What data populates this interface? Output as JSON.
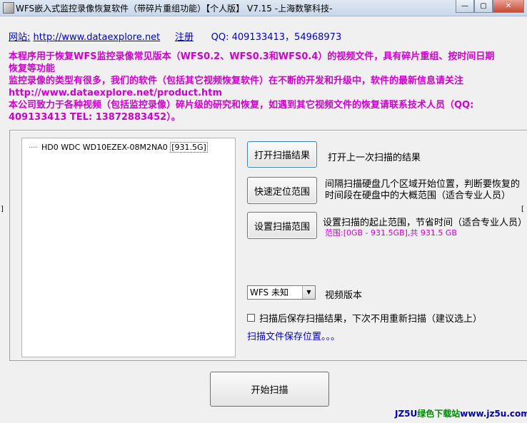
{
  "window": {
    "title": "WFS嵌入式监控录像恢复软件（带碎片重组功能）【个人版】 V7.15  -上海数擎科技-",
    "btn_minimize": "—",
    "btn_maximize": "▢",
    "btn_close": "✕"
  },
  "header": {
    "website_label": "网站:",
    "website_url": "http://www.dataexplore.net",
    "register": "注册",
    "qq": "QQ: 409133413，54968973"
  },
  "notice": [
    "本程序用于恢复WFS监控录像常见版本（WFS0.2、WFS0.3和WFS0.4）的视频文件，具有碎片重组、按时间日期恢复等功能",
    "监控录像的类型有很多，我们的软件（包括其它视频恢复软件）在不断的开发和升级中，软件的最新信息请关注 http://www.dataexplore.net/product.htm",
    "本公司致力于各种视频（包括监控录像）碎片级的研究和恢复，如遇到其它视频文件的恢复请联系技术人员（QQ: 409133413 TEL: 13872883452）。"
  ],
  "tree": {
    "dots": "·····",
    "disk": "HD0   WDC WD10EZEX-08M2NA0",
    "size": "[931.5G]"
  },
  "actions": {
    "open_label": "打开扫描结果",
    "open_desc": "打开上一次扫描的结果",
    "locate_label": "快速定位范围",
    "locate_desc": "间隔扫描硬盘几个区域开始位置，判断要恢复的时间段在硬盘中的大概范围（适合专业人员）",
    "range_label": "设置扫描范围",
    "range_desc": "设置扫描的起止范围，节省时间（适合专业人员）",
    "range_info": "范围:[0GB - 931.5GB],共 931.5 GB"
  },
  "options": {
    "version_selected": "WFS 未知",
    "version_label": "视频版本",
    "save_checkbox": "扫描后保存扫描结果，下次不用重新扫描（建议选上）",
    "save_location": "扫描文件保存位置。。。"
  },
  "start_button": "开始扫描",
  "watermark": {
    "prefix": "JZ5U",
    "mid": "绿色下载站",
    "site": "www.jz5u.com"
  }
}
